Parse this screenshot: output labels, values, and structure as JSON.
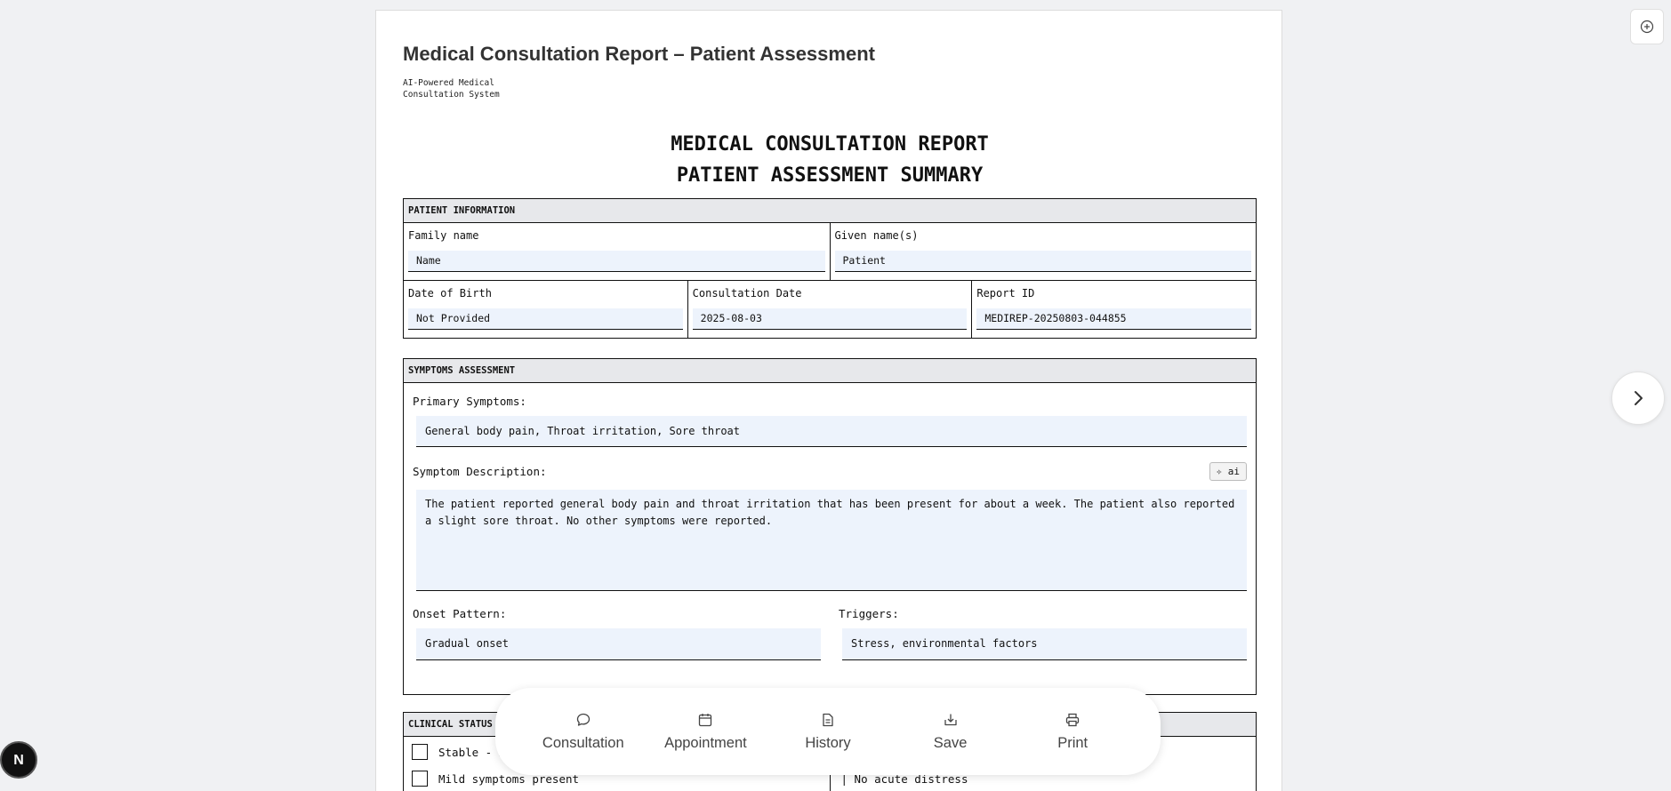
{
  "header": {
    "title": "Medical Consultation Report – Patient Assessment",
    "subtitle": "AI-Powered Medical Consultation System",
    "doc_title_1": "MEDICAL CONSULTATION REPORT",
    "doc_title_2": "PATIENT ASSESSMENT SUMMARY"
  },
  "patient_info": {
    "heading": "PATIENT INFORMATION",
    "family_name_label": "Family name",
    "family_name": "Name",
    "given_name_label": "Given name(s)",
    "given_name": "Patient",
    "dob_label": "Date of Birth",
    "dob": "Not Provided",
    "consult_date_label": "Consultation Date",
    "consult_date": "2025-08-03",
    "report_id_label": "Report ID",
    "report_id": "MEDIREP-20250803-044855"
  },
  "symptoms": {
    "heading": "SYMPTOMS ASSESSMENT",
    "primary_label": "Primary Symptoms:",
    "primary": "General body pain, Throat irritation, Sore throat",
    "description_label": "Symptom Description:",
    "ai_button": "✧ ai",
    "description": "The patient reported general body pain and throat irritation that has been present for about a week. The patient also reported a slight sore throat. No other symptoms were reported.",
    "onset_label": "Onset Pattern:",
    "onset": "Gradual onset",
    "triggers_label": "Triggers:",
    "triggers": "Stress, environmental factors"
  },
  "clinical_status": {
    "heading": "CLINICAL STATUS",
    "option_1": "Stable - N",
    "option_2": "Mild symptoms present",
    "option_3": "| No acute distress"
  },
  "dock": {
    "items": [
      {
        "label": "Consultation",
        "icon": "chat-icon"
      },
      {
        "label": "Appointment",
        "icon": "calendar-icon"
      },
      {
        "label": "History",
        "icon": "document-icon"
      },
      {
        "label": "Save",
        "icon": "download-icon"
      },
      {
        "label": "Print",
        "icon": "printer-icon"
      }
    ]
  },
  "badge": {
    "letter": "N"
  }
}
